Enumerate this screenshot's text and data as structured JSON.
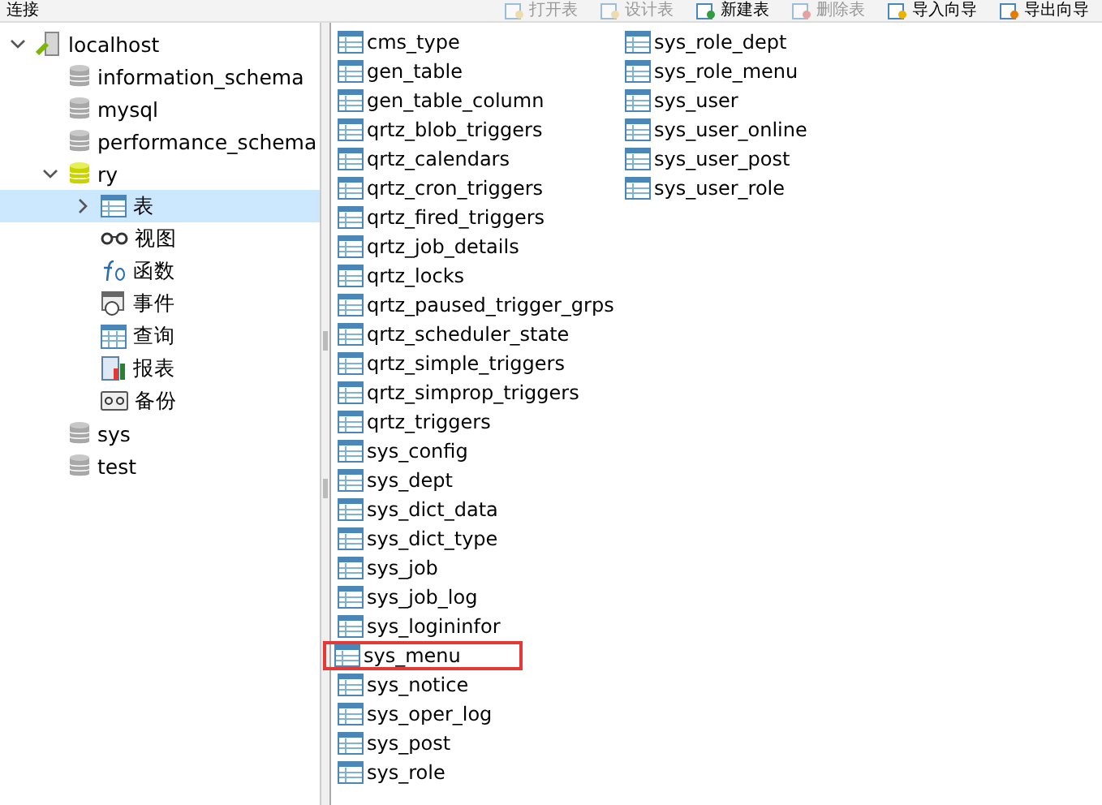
{
  "toolbar": {
    "title": "连接",
    "buttons": [
      {
        "label": "打开表",
        "kind": "open",
        "disabled": true
      },
      {
        "label": "设计表",
        "kind": "design",
        "disabled": true
      },
      {
        "label": "新建表",
        "kind": "new",
        "disabled": false
      },
      {
        "label": "删除表",
        "kind": "delete",
        "disabled": true
      },
      {
        "label": "导入向导",
        "kind": "import",
        "disabled": false
      },
      {
        "label": "导出向导",
        "kind": "export",
        "disabled": false
      }
    ]
  },
  "tree": [
    {
      "label": "localhost",
      "kind": "server",
      "expanded": true,
      "selected": false,
      "children": [
        {
          "label": "information_schema",
          "kind": "database",
          "selected": false
        },
        {
          "label": "mysql",
          "kind": "database",
          "selected": false
        },
        {
          "label": "performance_schema",
          "kind": "database",
          "selected": false
        },
        {
          "label": "ry",
          "kind": "database",
          "expanded": true,
          "selected": false,
          "children": [
            {
              "label": "表",
              "kind": "tables",
              "expanded": false,
              "selected": true
            },
            {
              "label": "视图",
              "kind": "views",
              "selected": false
            },
            {
              "label": "函数",
              "kind": "functions",
              "selected": false
            },
            {
              "label": "事件",
              "kind": "events",
              "selected": false
            },
            {
              "label": "查询",
              "kind": "queries",
              "selected": false
            },
            {
              "label": "报表",
              "kind": "reports",
              "selected": false
            },
            {
              "label": "备份",
              "kind": "backups",
              "selected": false
            }
          ]
        },
        {
          "label": "sys",
          "kind": "database",
          "selected": false
        },
        {
          "label": "test",
          "kind": "database",
          "selected": false
        }
      ]
    }
  ],
  "tables": [
    {
      "name": "cms_type",
      "highlighted": false
    },
    {
      "name": "gen_table",
      "highlighted": false
    },
    {
      "name": "gen_table_column",
      "highlighted": false
    },
    {
      "name": "qrtz_blob_triggers",
      "highlighted": false
    },
    {
      "name": "qrtz_calendars",
      "highlighted": false
    },
    {
      "name": "qrtz_cron_triggers",
      "highlighted": false
    },
    {
      "name": "qrtz_fired_triggers",
      "highlighted": false
    },
    {
      "name": "qrtz_job_details",
      "highlighted": false
    },
    {
      "name": "qrtz_locks",
      "highlighted": false
    },
    {
      "name": "qrtz_paused_trigger_grps",
      "highlighted": false
    },
    {
      "name": "qrtz_scheduler_state",
      "highlighted": false
    },
    {
      "name": "qrtz_simple_triggers",
      "highlighted": false
    },
    {
      "name": "qrtz_simprop_triggers",
      "highlighted": false
    },
    {
      "name": "qrtz_triggers",
      "highlighted": false
    },
    {
      "name": "sys_config",
      "highlighted": false
    },
    {
      "name": "sys_dept",
      "highlighted": false
    },
    {
      "name": "sys_dict_data",
      "highlighted": false
    },
    {
      "name": "sys_dict_type",
      "highlighted": false
    },
    {
      "name": "sys_job",
      "highlighted": false
    },
    {
      "name": "sys_job_log",
      "highlighted": false
    },
    {
      "name": "sys_logininfor",
      "highlighted": false
    },
    {
      "name": "sys_menu",
      "highlighted": true
    },
    {
      "name": "sys_notice",
      "highlighted": false
    },
    {
      "name": "sys_oper_log",
      "highlighted": false
    },
    {
      "name": "sys_post",
      "highlighted": false
    },
    {
      "name": "sys_role",
      "highlighted": false
    },
    {
      "name": "sys_role_dept",
      "highlighted": false
    },
    {
      "name": "sys_role_menu",
      "highlighted": false
    },
    {
      "name": "sys_user",
      "highlighted": false
    },
    {
      "name": "sys_user_online",
      "highlighted": false
    },
    {
      "name": "sys_user_post",
      "highlighted": false
    },
    {
      "name": "sys_user_role",
      "highlighted": false
    }
  ]
}
